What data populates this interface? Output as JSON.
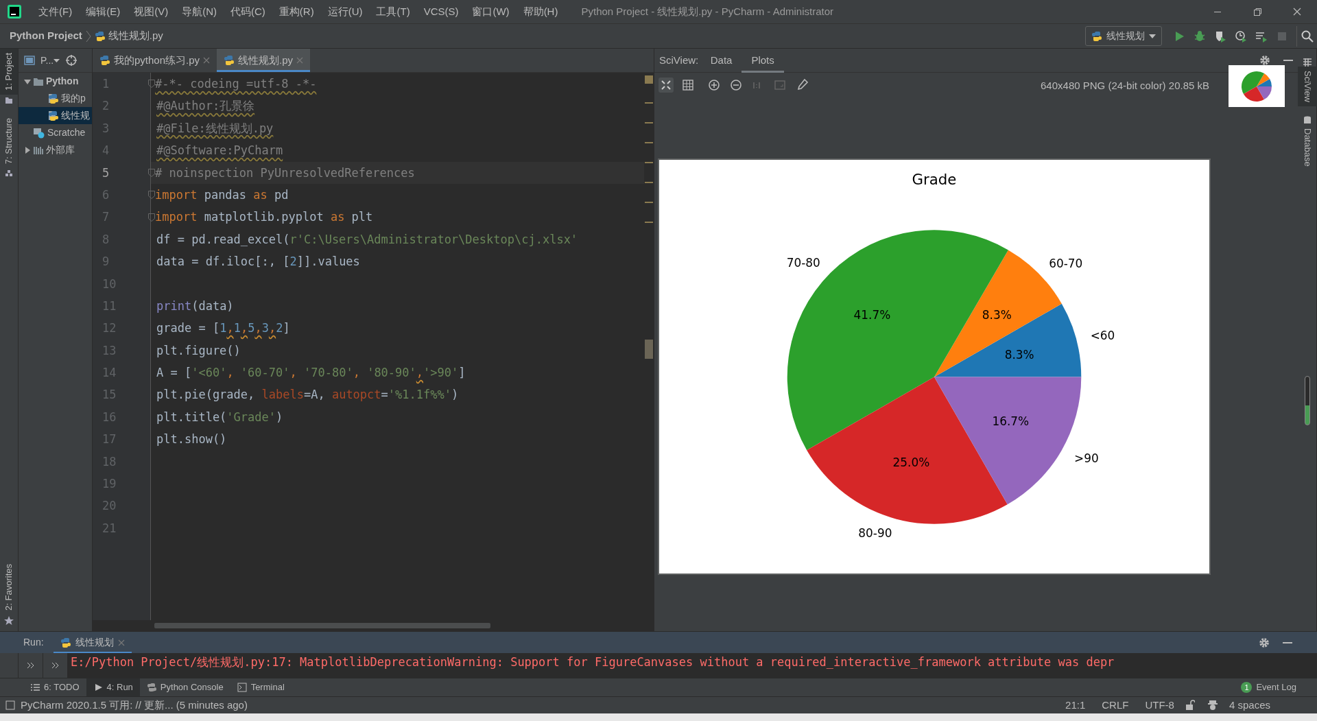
{
  "window": {
    "title": "Python Project - 线性规划.py - PyCharm - Administrator"
  },
  "menu": [
    "文件(F)",
    "编辑(E)",
    "视图(V)",
    "导航(N)",
    "代码(C)",
    "重构(R)",
    "运行(U)",
    "工具(T)",
    "VCS(S)",
    "窗口(W)",
    "帮助(H)"
  ],
  "breadcrumb": [
    "Python Project",
    "线性规划.py"
  ],
  "run_config": "线性规划",
  "left_stripe": [
    {
      "label": "1: Project",
      "selected": true
    },
    {
      "label": "7: Structure",
      "selected": false
    }
  ],
  "favorites_label": "2: Favorites",
  "project": {
    "selector": "P...",
    "tree": [
      {
        "label": "Python",
        "kind": "folder",
        "expanded": true,
        "selected": false,
        "children": [
          {
            "label": "我的p",
            "kind": "pyfile",
            "selected": false
          },
          {
            "label": "线性规",
            "kind": "pyfile",
            "selected": true
          }
        ]
      },
      {
        "label": "Scratche",
        "kind": "scratch",
        "selected": false
      },
      {
        "label": "外部库",
        "kind": "library",
        "expanded": false,
        "selected": false
      }
    ]
  },
  "editor_tabs": [
    {
      "label": "我的python练习.py",
      "selected": false
    },
    {
      "label": "线性规划.py",
      "selected": true
    }
  ],
  "code": [
    {
      "number": "1",
      "current": false,
      "fold": true,
      "tokens": [
        {
          "text": "#-*- codeing =utf-8 -*-",
          "kind": "warn-comment"
        }
      ]
    },
    {
      "number": "2",
      "current": false,
      "fold": false,
      "tokens": [
        {
          "text": "#@Author:孔景徐",
          "kind": "warn-comment"
        }
      ]
    },
    {
      "number": "3",
      "current": false,
      "fold": false,
      "tokens": [
        {
          "text": "#@File:线性规划.py",
          "kind": "warn-comment"
        }
      ]
    },
    {
      "number": "4",
      "current": false,
      "fold": false,
      "tokens": [
        {
          "text": "#@Software:PyCharm",
          "kind": "warn-comment"
        }
      ]
    },
    {
      "number": "5",
      "current": true,
      "fold": true,
      "tokens": [
        {
          "text": "# noinspection PyUnresolvedReferences",
          "kind": "comment"
        }
      ]
    },
    {
      "number": "6",
      "current": false,
      "fold": true,
      "tokens": [
        {
          "text": "import",
          "kind": "keyword"
        },
        {
          "text": " pandas ",
          "kind": "plain"
        },
        {
          "text": "as",
          "kind": "keyword"
        },
        {
          "text": " pd",
          "kind": "plain"
        }
      ]
    },
    {
      "number": "7",
      "current": false,
      "fold": true,
      "tokens": [
        {
          "text": "import",
          "kind": "keyword"
        },
        {
          "text": " matplotlib.pyplot ",
          "kind": "plain"
        },
        {
          "text": "as",
          "kind": "keyword"
        },
        {
          "text": " plt",
          "kind": "plain"
        }
      ]
    },
    {
      "number": "8",
      "current": false,
      "fold": false,
      "tokens": [
        {
          "text": "df = pd.read_excel(",
          "kind": "plain"
        },
        {
          "text": "r'C:\\Users\\Administrator\\Desktop\\cj.xlsx'",
          "kind": "string"
        }
      ]
    },
    {
      "number": "9",
      "current": false,
      "fold": false,
      "tokens": [
        {
          "text": "data = df.iloc[:, [",
          "kind": "plain"
        },
        {
          "text": "2",
          "kind": "number"
        },
        {
          "text": "]].values",
          "kind": "plain"
        }
      ]
    },
    {
      "number": "10",
      "current": false,
      "fold": false
    },
    {
      "number": "11",
      "current": false,
      "fold": false,
      "tokens": [
        {
          "text": "print",
          "kind": "builtin"
        },
        {
          "text": "(data)",
          "kind": "plain"
        }
      ]
    },
    {
      "number": "12",
      "current": false,
      "fold": false,
      "tokens": [
        {
          "text": "grade = [",
          "kind": "plain"
        },
        {
          "text": "1",
          "kind": "number"
        },
        {
          "text": ",",
          "kind": "warn-punct"
        },
        {
          "text": "1",
          "kind": "number"
        },
        {
          "text": ",",
          "kind": "warn-punct"
        },
        {
          "text": "5",
          "kind": "number"
        },
        {
          "text": ",",
          "kind": "warn-punct"
        },
        {
          "text": "3",
          "kind": "number"
        },
        {
          "text": ",",
          "kind": "warn-punct"
        },
        {
          "text": "2",
          "kind": "number"
        },
        {
          "text": "]",
          "kind": "plain"
        }
      ]
    },
    {
      "number": "13",
      "current": false,
      "fold": false,
      "tokens": [
        {
          "text": "plt.figure()",
          "kind": "plain"
        }
      ]
    },
    {
      "number": "14",
      "current": false,
      "fold": false,
      "tokens": [
        {
          "text": "A = [",
          "kind": "plain"
        },
        {
          "text": "'<60'",
          "kind": "string"
        },
        {
          "text": ", ",
          "kind": "keyword"
        },
        {
          "text": "'60-70'",
          "kind": "string"
        },
        {
          "text": ", ",
          "kind": "keyword"
        },
        {
          "text": "'70-80'",
          "kind": "string"
        },
        {
          "text": ", ",
          "kind": "keyword"
        },
        {
          "text": "'80-90'",
          "kind": "string"
        },
        {
          "text": ",",
          "kind": "warn-punct"
        },
        {
          "text": "'>90'",
          "kind": "string"
        },
        {
          "text": "]",
          "kind": "plain"
        }
      ]
    },
    {
      "number": "15",
      "current": false,
      "fold": false,
      "tokens": [
        {
          "text": "plt.pie(grade, ",
          "kind": "plain"
        },
        {
          "text": "labels",
          "kind": "param"
        },
        {
          "text": "=A, ",
          "kind": "plain"
        },
        {
          "text": "autopct",
          "kind": "param"
        },
        {
          "text": "=",
          "kind": "plain"
        },
        {
          "text": "'%1.1f%%'",
          "kind": "string"
        },
        {
          "text": ")",
          "kind": "plain"
        }
      ]
    },
    {
      "number": "16",
      "current": false,
      "fold": false,
      "tokens": [
        {
          "text": "plt.title(",
          "kind": "plain"
        },
        {
          "text": "'Grade'",
          "kind": "string"
        },
        {
          "text": ")",
          "kind": "plain"
        }
      ]
    },
    {
      "number": "17",
      "current": false,
      "fold": false,
      "tokens": [
        {
          "text": "plt.show()",
          "kind": "plain"
        }
      ]
    },
    {
      "number": "18",
      "current": false,
      "fold": false
    },
    {
      "number": "19",
      "current": false,
      "fold": false
    },
    {
      "number": "20",
      "current": false,
      "fold": false
    },
    {
      "number": "21",
      "current": false,
      "fold": false
    }
  ],
  "sciview": {
    "label": "SciView:",
    "tabs": [
      {
        "label": "Data",
        "selected": false
      },
      {
        "label": "Plots",
        "selected": true
      }
    ],
    "image_info": "640x480 PNG (24-bit color) 20.85 kB",
    "chart_data": {
      "type": "pie",
      "title": "Grade",
      "categories": [
        "<60",
        "60-70",
        "70-80",
        "80-90",
        ">90"
      ],
      "values": [
        8.3,
        8.3,
        41.7,
        25.0,
        16.7
      ],
      "colors": [
        "#1f77b4",
        "#ff7f0e",
        "#2ca02c",
        "#d62728",
        "#9467bd"
      ],
      "value_labels": [
        "8.3%",
        "8.3%",
        "41.7%",
        "25.0%",
        "16.7%"
      ]
    }
  },
  "right_stripe": [
    {
      "label": "SciView",
      "selected": true
    },
    {
      "label": "Database",
      "selected": false
    }
  ],
  "run": {
    "label": "Run:",
    "tab": "线性规划",
    "output": "E:/Python Project/线性规划.py:17: MatplotlibDeprecationWarning: Support for FigureCanvases without a required_interactive_framework attribute was depr"
  },
  "tool_windows": [
    {
      "label": "6: TODO",
      "kind": "todo",
      "selected": false
    },
    {
      "label": "4: Run",
      "kind": "run",
      "selected": true
    },
    {
      "label": "Python Console",
      "kind": "console",
      "selected": false
    },
    {
      "label": "Terminal",
      "kind": "terminal",
      "selected": false
    }
  ],
  "event_log": {
    "label": "Event Log",
    "count": "1"
  },
  "status_bar": {
    "message": "PyCharm 2020.1.5 可用: // 更新... (5 minutes ago)",
    "position": "21:1",
    "line_separator": "CRLF",
    "encoding": "UTF-8",
    "indent": "4 spaces"
  }
}
